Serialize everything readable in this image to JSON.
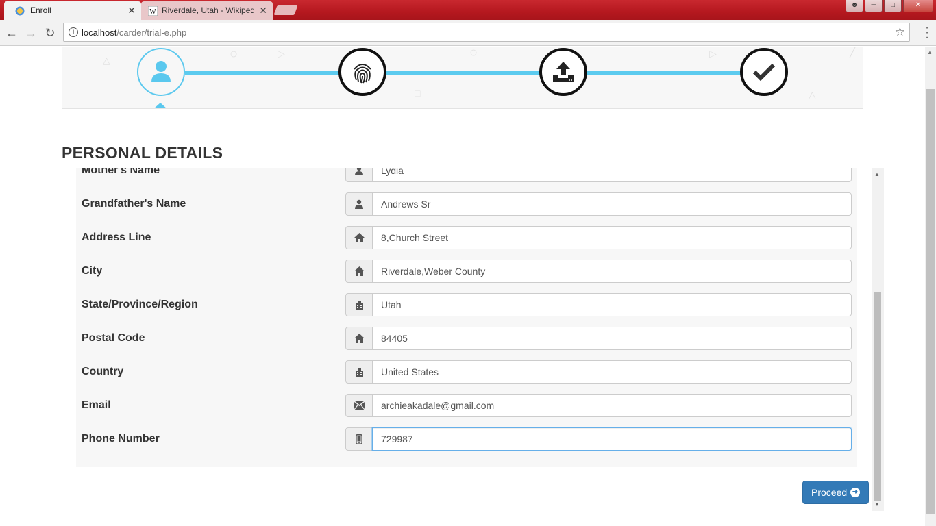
{
  "browser": {
    "tabs": [
      {
        "title": "Enroll",
        "active": true
      },
      {
        "title": "Riverdale, Utah - Wikipedia",
        "active": false
      }
    ],
    "url_host": "localhost",
    "url_path": "/carder/trial-e.php",
    "tab_close": "✕"
  },
  "stepper": {
    "steps": [
      {
        "icon": "user-icon",
        "state": "active"
      },
      {
        "icon": "fingerprint-icon",
        "state": "pending"
      },
      {
        "icon": "upload-icon",
        "state": "pending"
      },
      {
        "icon": "check-icon",
        "state": "pending"
      }
    ],
    "accent_color": "#5ccbef"
  },
  "section_title": "PERSONAL DETAILS",
  "form": {
    "fields": [
      {
        "label": "Mother's Name",
        "icon": "user-icon",
        "value": "Lydia"
      },
      {
        "label": "Grandfather's Name",
        "icon": "user-icon",
        "value": "Andrews Sr"
      },
      {
        "label": "Address Line",
        "icon": "home-icon",
        "value": "8,Church Street"
      },
      {
        "label": "City",
        "icon": "home-icon",
        "value": "Riverdale,Weber County"
      },
      {
        "label": "State/Province/Region",
        "icon": "building-icon",
        "value": "Utah"
      },
      {
        "label": "Postal Code",
        "icon": "home-icon",
        "value": "84405"
      },
      {
        "label": "Country",
        "icon": "building-icon",
        "value": "United States"
      },
      {
        "label": "Email",
        "icon": "envelope-icon",
        "value": "archieakadale@gmail.com"
      },
      {
        "label": "Phone Number",
        "icon": "phone-icon",
        "value": "729987"
      }
    ]
  },
  "proceed_label": "Proceed",
  "colors": {
    "primary": "#337ab7",
    "browser_frame": "#c1272d"
  }
}
